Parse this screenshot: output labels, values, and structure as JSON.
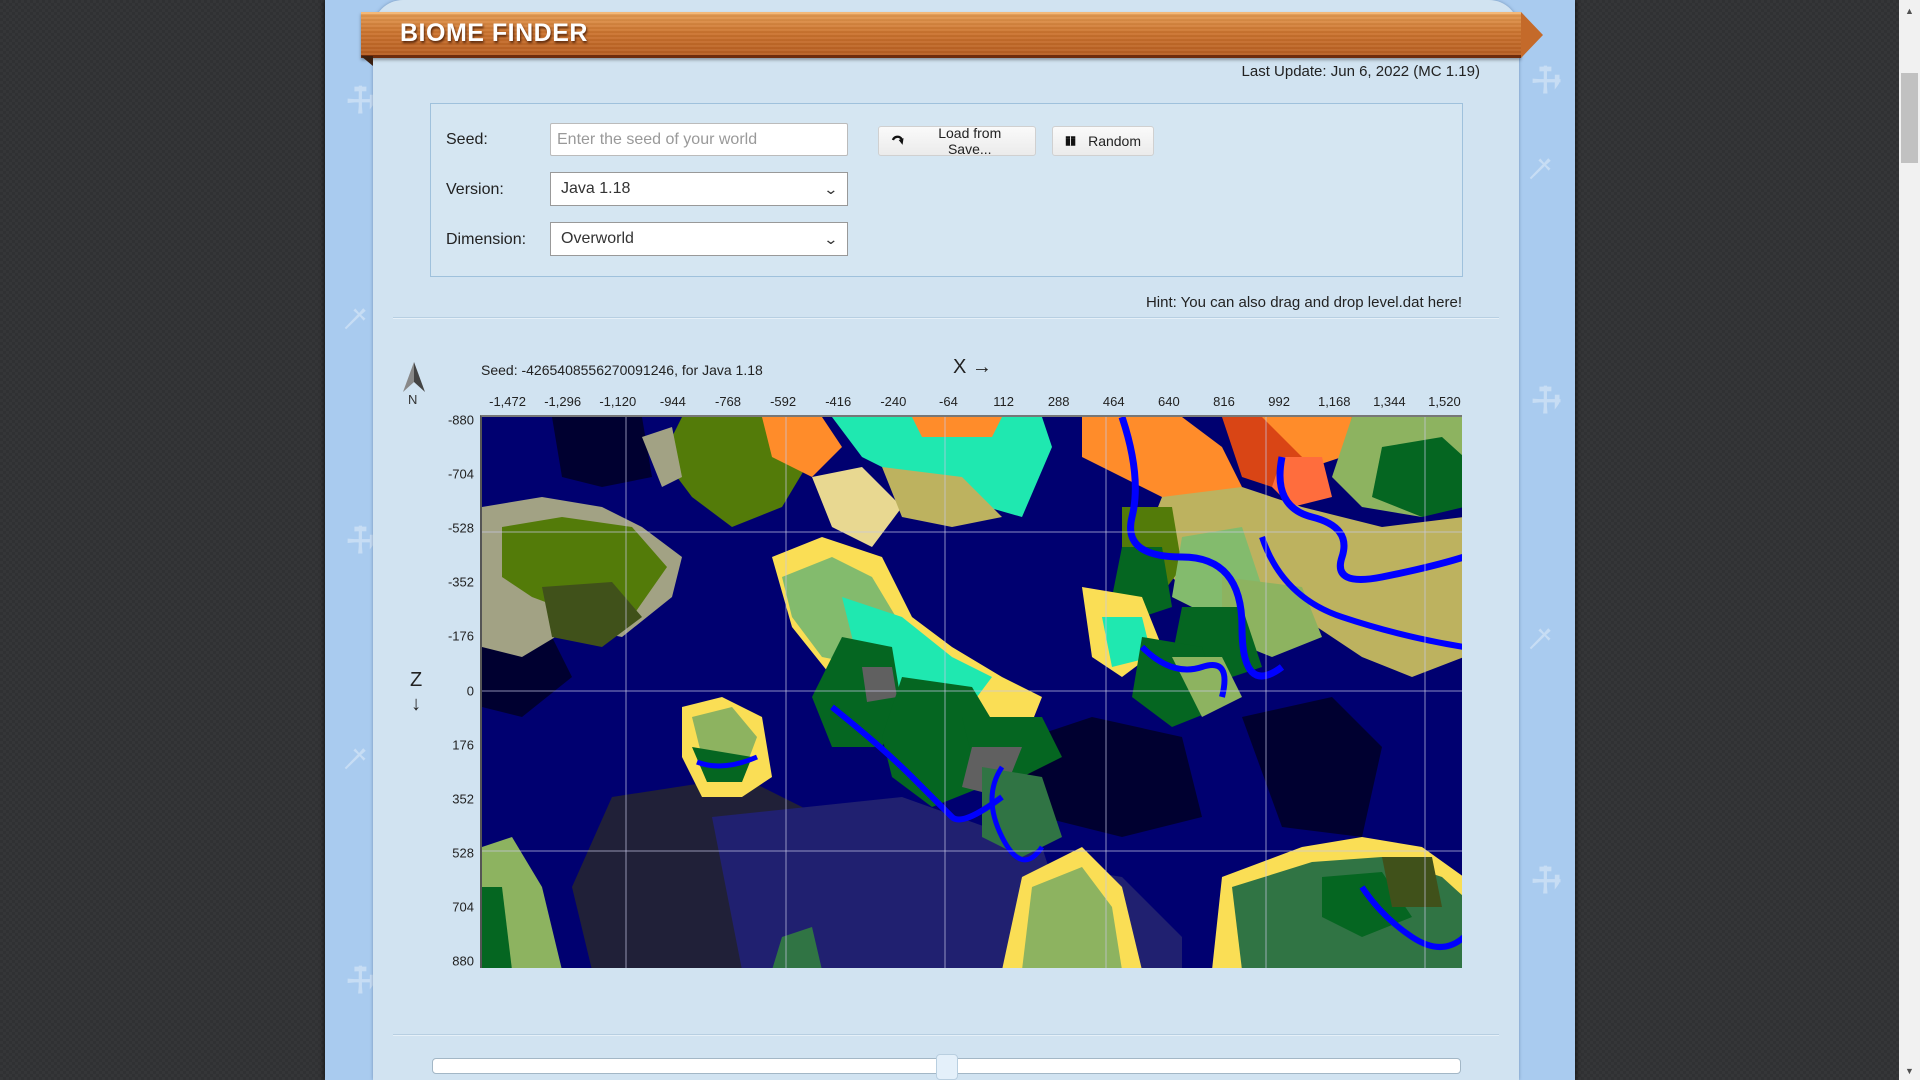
{
  "header": {
    "title": "BIOME FINDER",
    "last_update": "Last Update: Jun 6, 2022 (MC 1.19)"
  },
  "form": {
    "seed_label": "Seed:",
    "seed_value": "",
    "seed_placeholder": "Enter the seed of your world",
    "version_label": "Version:",
    "version_value": "Java 1.18",
    "dimension_label": "Dimension:",
    "dimension_value": "Overworld",
    "load_button": "Load from Save...",
    "load_icon": "redo-arrow-icon",
    "random_button": "Random",
    "random_icon": "gift-box-icon"
  },
  "hint": "Hint: You can also drag and drop level.dat here!",
  "map": {
    "compass_label": "N",
    "seed_caption": "Seed: -4265408556270091246, for Java 1.18",
    "x_axis_label": "X →",
    "z_axis_label": "Z",
    "z_axis_arrow": "↓",
    "x_ticks": [
      "-1,472",
      "-1,296",
      "-1,120",
      "-944",
      "-768",
      "-592",
      "-416",
      "-240",
      "-64",
      "112",
      "288",
      "464",
      "640",
      "816",
      "992",
      "1,168",
      "1,344",
      "1,520"
    ],
    "z_ticks": [
      "-880",
      "-704",
      "-528",
      "-352",
      "-176",
      "0",
      "176",
      "352",
      "528",
      "704",
      "880"
    ],
    "x_range": [
      -1560,
      1576
    ],
    "z_range": [
      -880,
      880
    ],
    "grid_step_blocks": 512,
    "biome_colors": {
      "deep_ocean": "#000030",
      "ocean": "#000070",
      "deep_cold_ocean": "#202070",
      "deep_frozen_ocean": "#202038",
      "river": "#0000ff",
      "beach": "#fade55",
      "plains": "#8db360",
      "forest": "#056621",
      "birch_forest": "#307444",
      "dark_forest": "#40511a",
      "savanna": "#bdb25f",
      "badlands": "#d94515",
      "wooded_badlands": "#ff8c2a",
      "eroded_badlands": "#ff6d3d",
      "jungle": "#537b09",
      "sparse_jungle": "#628b17",
      "lush": "#1fe8b0",
      "stony_shore": "#a2a284",
      "windswept": "#606060",
      "meadow": "#83bb6d",
      "desert_like": "#e8d891"
    }
  },
  "slider": {
    "value_fraction": 0.5
  }
}
